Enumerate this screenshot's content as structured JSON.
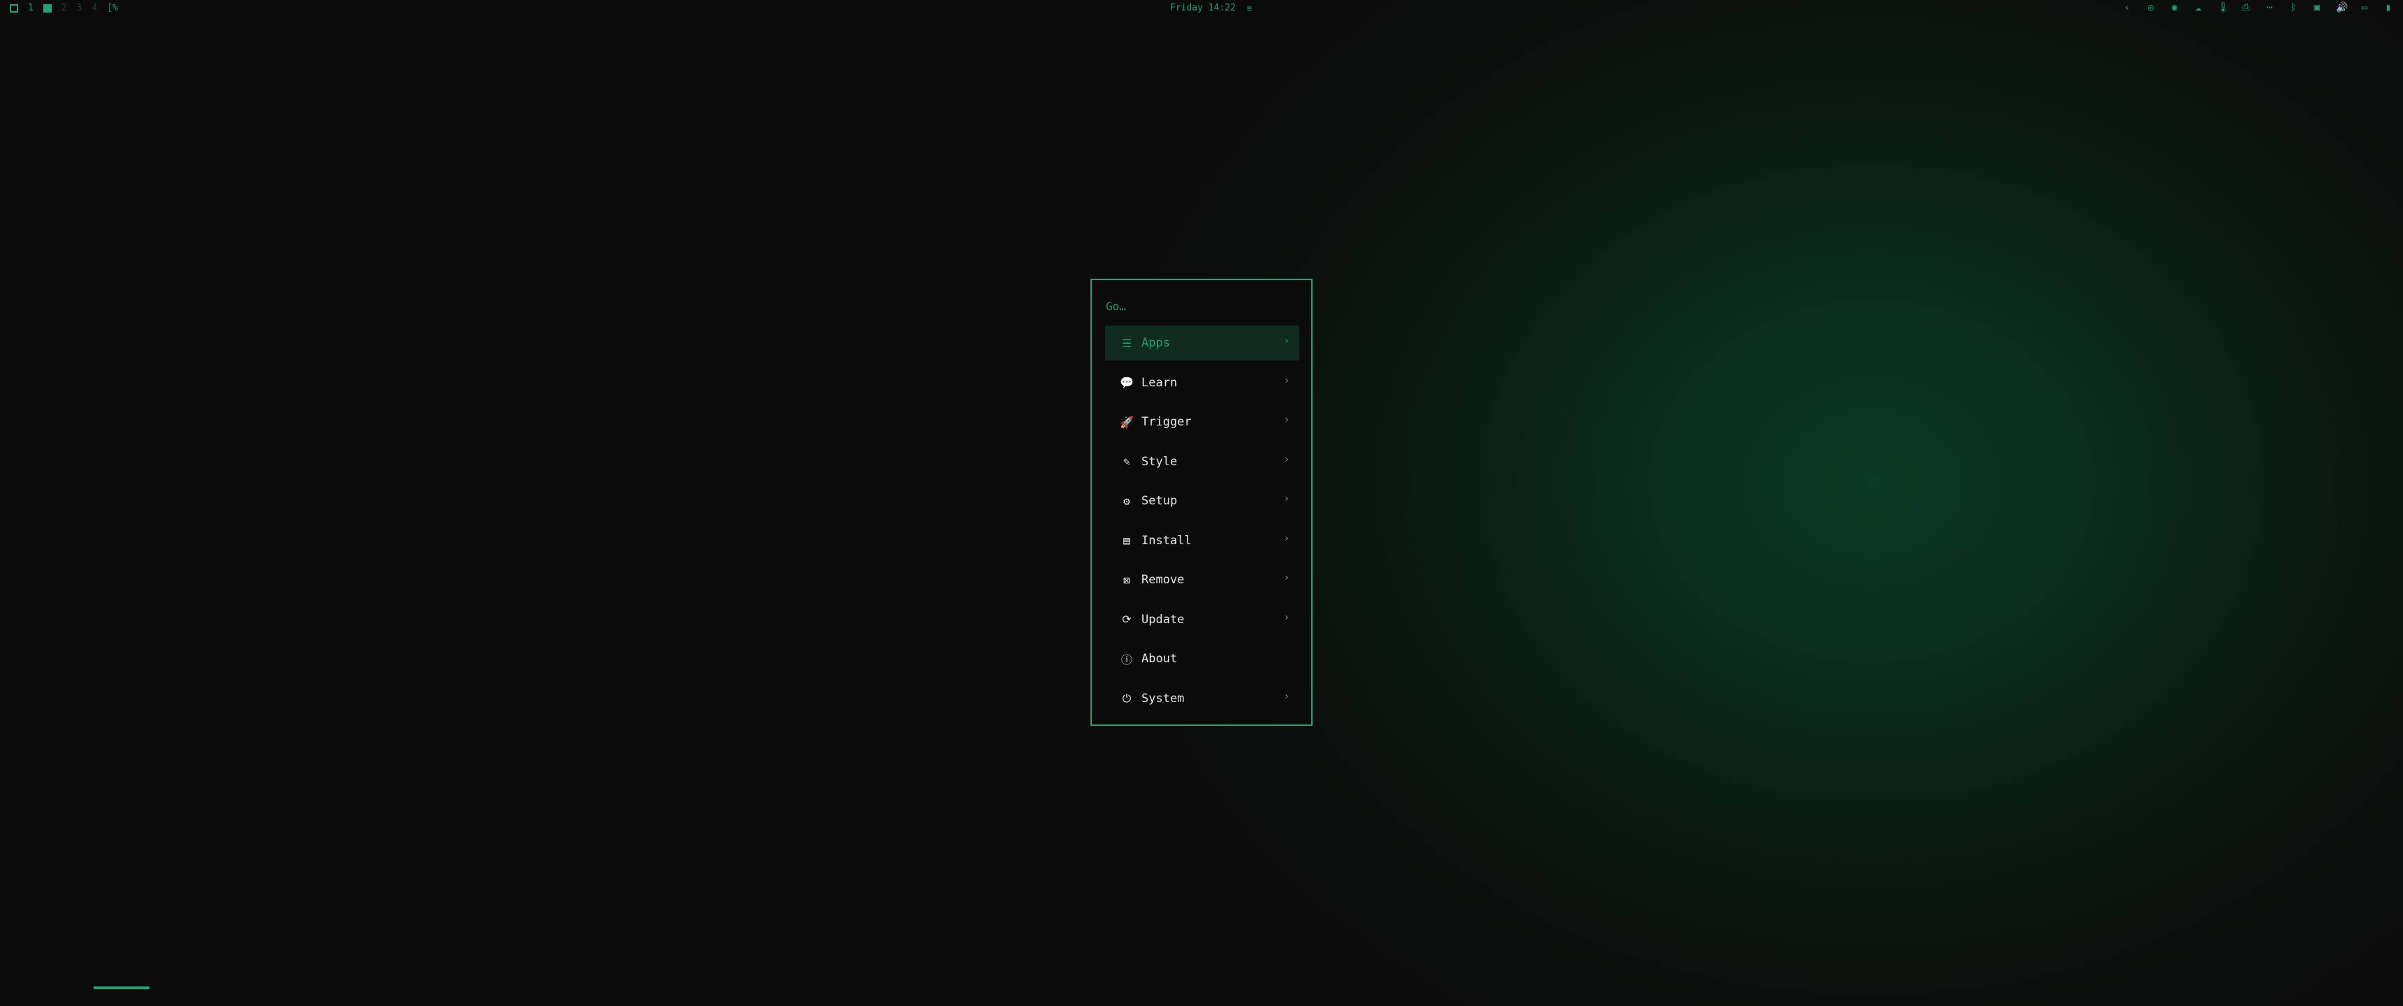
{
  "topbar": {
    "workspace_active": "1",
    "workspaces_dim": [
      "2",
      "3",
      "4"
    ],
    "indicator": "[%",
    "clock": "Friday 14:22",
    "notif_glyph": "≡",
    "tray": [
      {
        "name": "chevron-left-icon",
        "glyph": "‹"
      },
      {
        "name": "steam-icon",
        "glyph": "◎"
      },
      {
        "name": "eye-icon",
        "glyph": "◉"
      },
      {
        "name": "cloud-icon",
        "glyph": "☁"
      },
      {
        "name": "thermometer-icon",
        "glyph": "🌡"
      },
      {
        "name": "printer-icon",
        "glyph": "⎙"
      },
      {
        "name": "dots-icon",
        "glyph": "⋯"
      },
      {
        "name": "bluetooth-icon",
        "glyph": "ᛒ"
      },
      {
        "name": "screen-icon",
        "glyph": "▣"
      },
      {
        "name": "volume-icon",
        "glyph": "🔊"
      },
      {
        "name": "monitor-icon",
        "glyph": "▭"
      },
      {
        "name": "battery-icon",
        "glyph": "▮"
      }
    ]
  },
  "menu": {
    "search_placeholder": "Go…",
    "items": [
      {
        "label": "Apps",
        "icon": "list-icon",
        "glyph": "☰",
        "active": true,
        "chevron": "›"
      },
      {
        "label": "Learn",
        "icon": "chat-icon",
        "glyph": "💬",
        "active": false,
        "chevron": "›"
      },
      {
        "label": "Trigger",
        "icon": "rocket-icon",
        "glyph": "🚀",
        "active": false,
        "chevron": "›"
      },
      {
        "label": "Style",
        "icon": "magic-wand-icon",
        "glyph": "✎",
        "active": false,
        "chevron": "›"
      },
      {
        "label": "Setup",
        "icon": "gear-icon",
        "glyph": "⚙",
        "active": false,
        "chevron": "›"
      },
      {
        "label": "Install",
        "icon": "save-icon",
        "glyph": "▤",
        "active": false,
        "chevron": "›"
      },
      {
        "label": "Remove",
        "icon": "remove-icon",
        "glyph": "⊠",
        "active": false,
        "chevron": "›"
      },
      {
        "label": "Update",
        "icon": "refresh-icon",
        "glyph": "⟳",
        "active": false,
        "chevron": "›"
      },
      {
        "label": "About",
        "icon": "info-icon",
        "glyph": "ⓘ",
        "active": false,
        "chevron": ""
      },
      {
        "label": "System",
        "icon": "power-icon",
        "glyph": "⏻",
        "active": false,
        "chevron": "›"
      }
    ]
  },
  "colors": {
    "accent": "#1fa56f",
    "background": "#0b0b0b",
    "active_row": "#0f2b1f",
    "text": "#e6e6e6"
  }
}
